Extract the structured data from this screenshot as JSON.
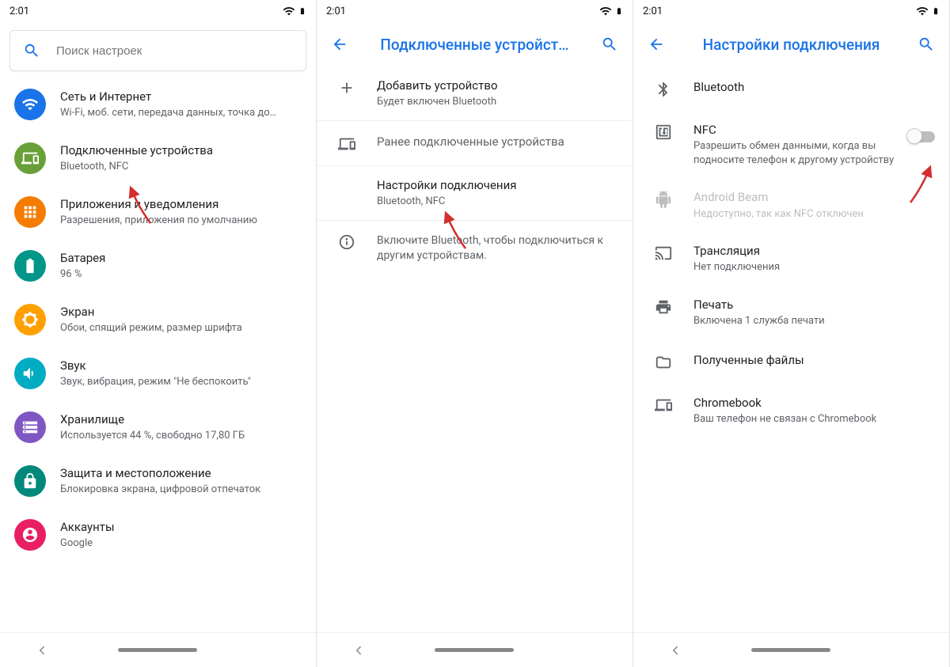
{
  "status": {
    "time": "2:01"
  },
  "screen1": {
    "search_placeholder": "Поиск настроек",
    "items": [
      {
        "title": "Сеть и Интернет",
        "sub": "Wi-Fi, моб. сети, передача данных, точка до…"
      },
      {
        "title": "Подключенные устройства",
        "sub": "Bluetooth, NFC"
      },
      {
        "title": "Приложения и уведомления",
        "sub": "Разрешения, приложения по умолчанию"
      },
      {
        "title": "Батарея",
        "sub": "96 %"
      },
      {
        "title": "Экран",
        "sub": "Обои, спящий режим, размер шрифта"
      },
      {
        "title": "Звук",
        "sub": "Звук, вибрация, режим \"Не беспокоить\""
      },
      {
        "title": "Хранилище",
        "sub": "Используется 44 %, свободно 17,80 ГБ"
      },
      {
        "title": "Защита и местоположение",
        "sub": "Блокировка экрана, цифровой отпечаток"
      },
      {
        "title": "Аккаунты",
        "sub": "Google"
      }
    ]
  },
  "screen2": {
    "header": "Подключенные устройст…",
    "add": {
      "title": "Добавить устройство",
      "sub": "Будет включен Bluetooth"
    },
    "prev_header": "Ранее подключенные устройства",
    "prefs": {
      "title": "Настройки подключения",
      "sub": "Bluetooth, NFC"
    },
    "info": "Включите Bluetooth, чтобы подключиться к другим устройствам."
  },
  "screen3": {
    "header": "Настройки подключения",
    "items": {
      "bluetooth": {
        "title": "Bluetooth"
      },
      "nfc": {
        "title": "NFC",
        "sub": "Разрешить обмен данными, когда вы подносите телефон к другому устройству"
      },
      "beam": {
        "title": "Android Beam",
        "sub": "Недоступно, так как NFC отключен"
      },
      "cast": {
        "title": "Трансляция",
        "sub": "Нет подключения"
      },
      "print": {
        "title": "Печать",
        "sub": "Включена 1 служба печати"
      },
      "files": {
        "title": "Полученные файлы"
      },
      "chromebook": {
        "title": "Chromebook",
        "sub": "Ваш телефон не связан с Chromebook"
      }
    }
  }
}
